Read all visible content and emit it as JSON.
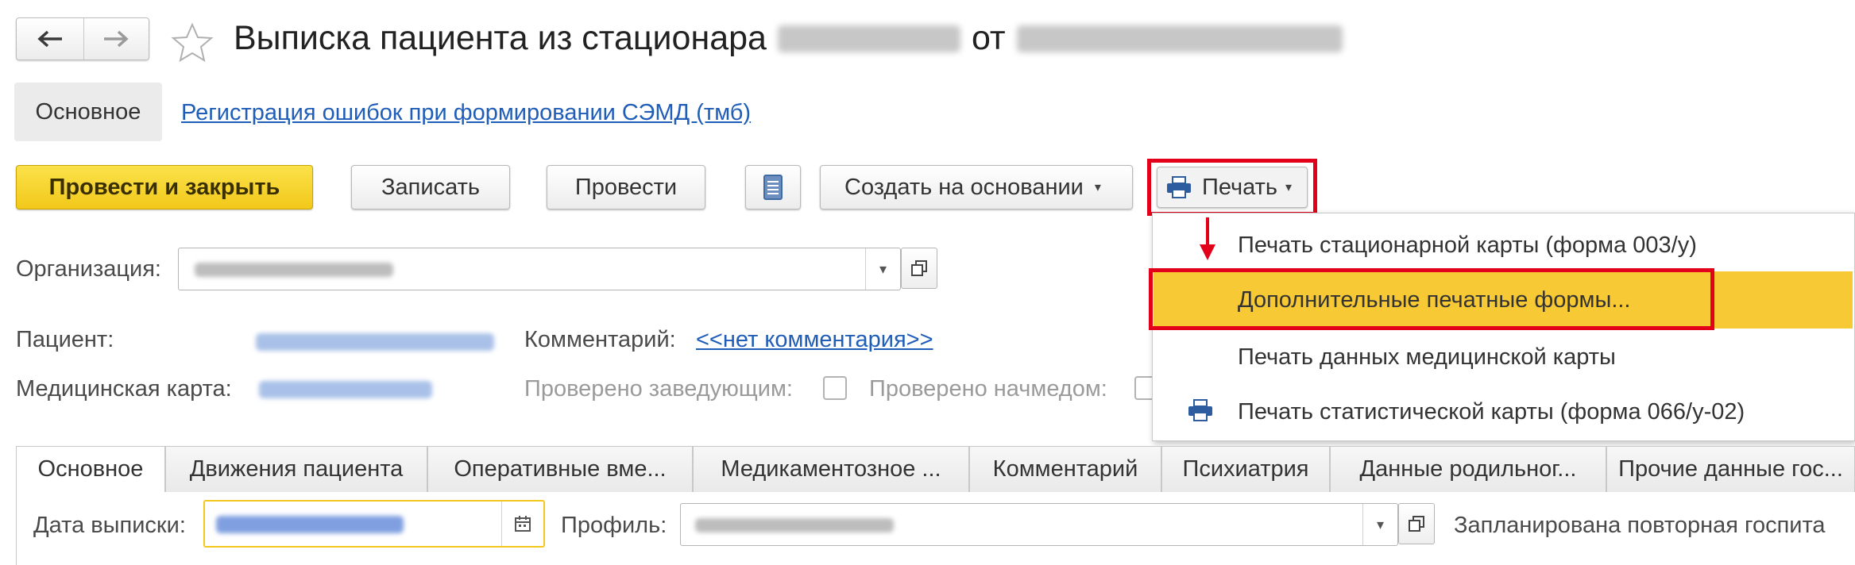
{
  "header": {
    "title_prefix": "Выписка пациента из стационара",
    "title_from": "от",
    "back_icon": "arrow-left-icon",
    "forward_icon": "arrow-right-icon",
    "favorite_icon": "star-icon"
  },
  "nav": {
    "main_tab": "Основное",
    "link": "Регистрация ошибок при формировании СЭМД (тмб)"
  },
  "toolbar": {
    "post_close": "Провести и закрыть",
    "save": "Записать",
    "post": "Провести",
    "create_based": "Создать на основании",
    "print": "Печать"
  },
  "print_menu": {
    "items": [
      "Печать стационарной карты (форма 003/у)",
      "Дополнительные печатные формы...",
      "Печать данных медицинской карты",
      "Печать статистической карты (форма 066/у-02)"
    ]
  },
  "form": {
    "organization_label": "Организация:",
    "patient_label": "Пациент:",
    "comment_label": "Комментарий:",
    "comment_link": "<<нет комментария>>",
    "medcard_label": "Медицинская карта:",
    "checked_head_label": "Проверено заведующим:",
    "checked_chief_label": "Проверено начмедом:"
  },
  "tabs": [
    "Основное",
    "Движения пациента",
    "Оперативные вме...",
    "Медикаментозное ...",
    "Комментарий",
    "Психиатрия",
    "Данные родильног...",
    "Прочие данные гос..."
  ],
  "bottom": {
    "discharge_date_label": "Дата выписки:",
    "profile_label": "Профиль:",
    "repeat_hosp_label": "Запланирована повторная госпита"
  },
  "colors": {
    "accent_yellow": "#f5d327",
    "highlight_yellow": "#f7c934",
    "annotation_red": "#e3001b",
    "link_blue": "#1f5db8"
  }
}
